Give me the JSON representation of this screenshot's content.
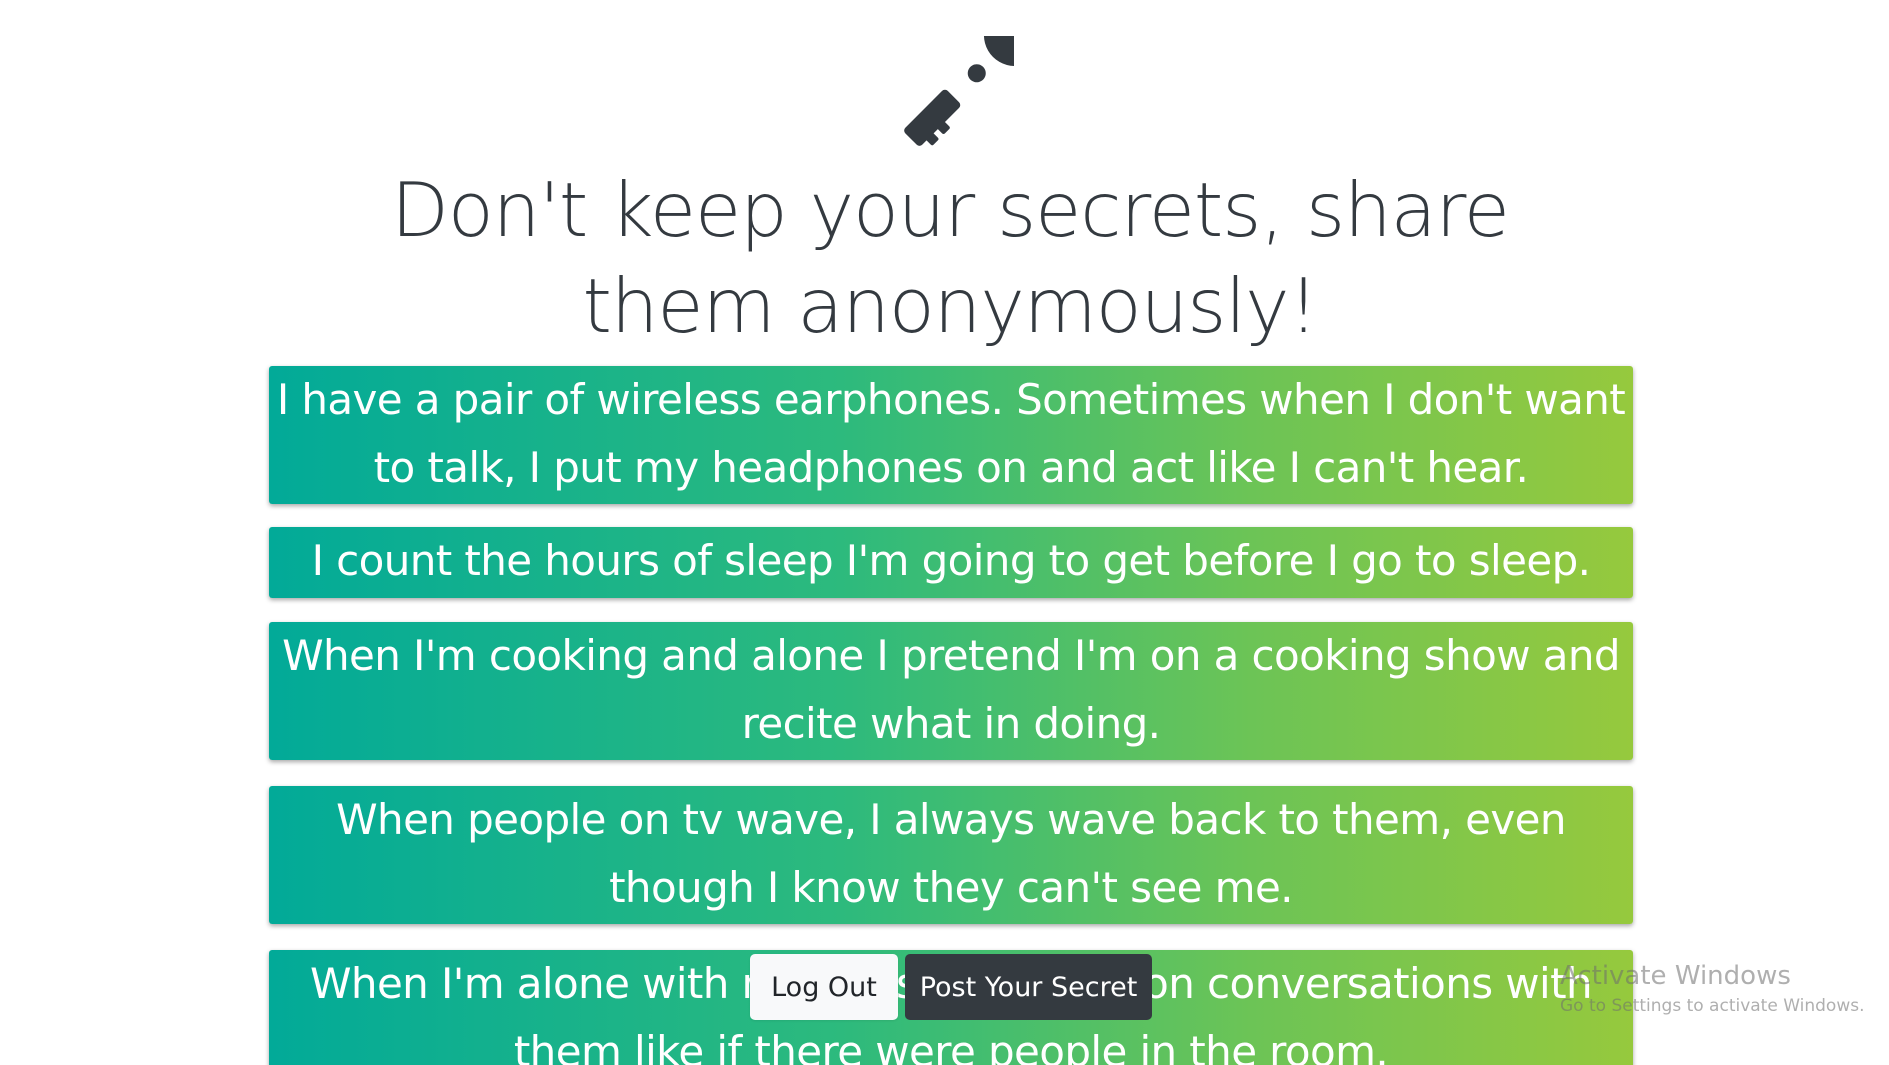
{
  "header": {
    "icon": "key-icon",
    "icon_color": "#343a40",
    "title": "Don't keep your secrets, share them anonymously!"
  },
  "secrets": [
    "I have a pair of wireless earphones. Sometimes when I don't want to talk, I put my headphones on and act like I can't hear.",
    "I count the hours of sleep I'm going to get before I go to sleep.",
    "When I'm cooking and alone I pretend I'm on a cooking show and recite what in doing.",
    "When people on tv wave, I always wave back to them, even though I know they can't see me.",
    "When I'm alone with my dogs I have full on conversations with them like if there were people in the room."
  ],
  "actions": {
    "logout_label": "Log Out",
    "post_label": "Post Your Secret"
  },
  "watermark": {
    "line1": "Activate Windows",
    "line2": "Go to Settings to activate Windows."
  },
  "colors": {
    "gradient_start": "#02aa98",
    "gradient_end": "#96c93d",
    "dark": "#343a40",
    "light": "#f8f9fa"
  }
}
